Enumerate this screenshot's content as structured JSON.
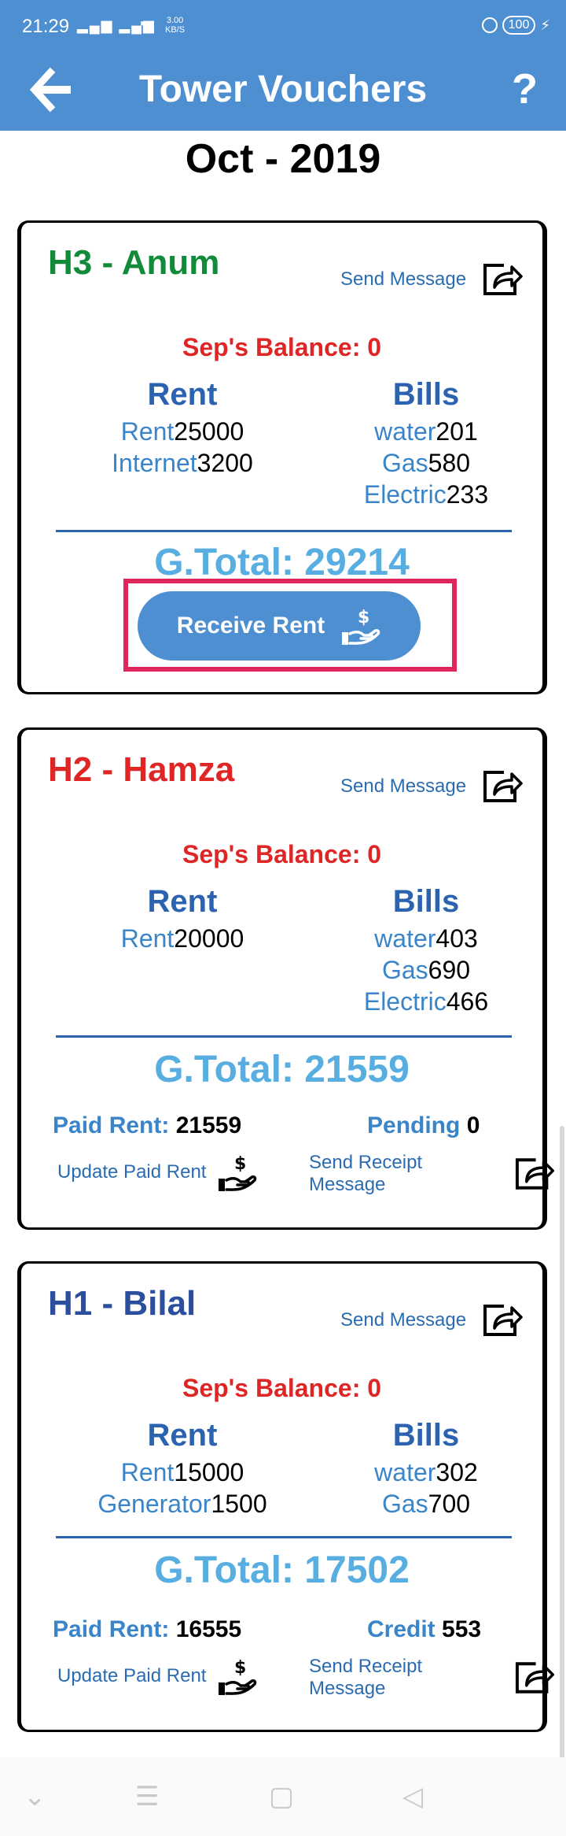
{
  "status_bar": {
    "time": "21:29",
    "net_speed_value": "3.00",
    "net_speed_unit": "KB/S",
    "battery": "100"
  },
  "app_bar": {
    "title": "Tower Vouchers",
    "help_label": "?"
  },
  "month": "Oct - 2019",
  "cards": [
    {
      "name": "H3 - Anum",
      "name_color": "#118a3a",
      "send_message": "Send Message",
      "balance": "Sep's Balance: 0",
      "rent_header": "Rent",
      "bills_header": "Bills",
      "rent_items": [
        {
          "label": "Rent",
          "value": "25000"
        },
        {
          "label": "Internet",
          "value": "3200"
        }
      ],
      "bills_items": [
        {
          "label": "water",
          "value": "201"
        },
        {
          "label": "Gas",
          "value": "580"
        },
        {
          "label": "Electric",
          "value": "233"
        }
      ],
      "gtotal": "G.Total: 29214",
      "receive_button": "Receive Rent"
    },
    {
      "name": "H2 - Hamza",
      "name_color": "#e02525",
      "send_message": "Send Message",
      "balance": "Sep's Balance: 0",
      "rent_header": "Rent",
      "bills_header": "Bills",
      "rent_items": [
        {
          "label": "Rent",
          "value": "20000"
        }
      ],
      "bills_items": [
        {
          "label": "water",
          "value": "403"
        },
        {
          "label": "Gas",
          "value": "690"
        },
        {
          "label": "Electric",
          "value": "466"
        }
      ],
      "gtotal": "G.Total: 21559",
      "paid_label": "Paid Rent:",
      "paid_value": "21559",
      "status_label": "Pending",
      "status_value": "0",
      "update_paid": "Update Paid Rent",
      "send_receipt": "Send Receipt Message"
    },
    {
      "name": "H1 - Bilal",
      "name_color": "#2b4f9e",
      "send_message": "Send Message",
      "balance": "Sep's Balance: 0",
      "rent_header": "Rent",
      "bills_header": "Bills",
      "rent_items": [
        {
          "label": "Rent",
          "value": "15000"
        },
        {
          "label": "Generator",
          "value": "1500"
        }
      ],
      "bills_items": [
        {
          "label": "water",
          "value": "302"
        },
        {
          "label": "Gas",
          "value": "700"
        }
      ],
      "gtotal": "G.Total: 17502",
      "paid_label": "Paid Rent:",
      "paid_value": "16555",
      "status_label": "Credit",
      "status_value": "553",
      "update_paid": "Update Paid Rent",
      "send_receipt": "Send Receipt Message"
    }
  ],
  "icons": {
    "back": "back-arrow-icon",
    "share": "share-icon",
    "hand_dollar": "hand-dollar-icon"
  },
  "colors": {
    "primary": "#4e8fd1",
    "balance_red": "#e02525",
    "total_blue": "#58aee0",
    "highlight_frame": "#e0275c"
  }
}
